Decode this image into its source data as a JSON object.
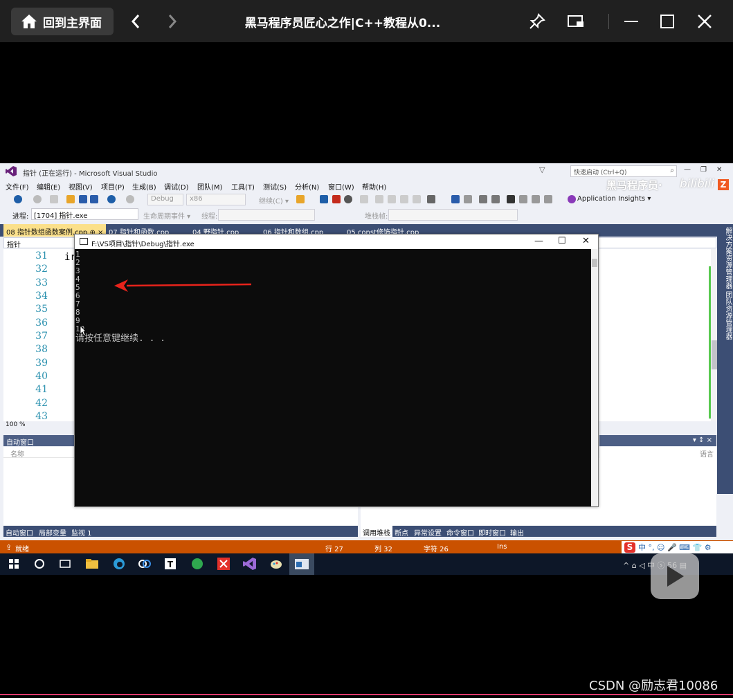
{
  "player": {
    "home_label": "回到主界面",
    "title": "黑马程序员匠心之作|C++教程从0..."
  },
  "vs": {
    "window_title": "指针 (正在运行) - Microsoft Visual Studio",
    "quick_launch": "快速启动 (Ctrl+Q)",
    "menu": [
      "文件(F)",
      "编辑(E)",
      "视图(V)",
      "项目(P)",
      "生成(B)",
      "调试(D)",
      "团队(M)",
      "工具(T)",
      "测试(S)",
      "分析(N)",
      "窗口(W)",
      "帮助(H)"
    ],
    "brand": "黑马程序员·",
    "brand_bili": "bilibili",
    "brand_z": "Z",
    "toolbar": {
      "config": "Debug",
      "platform": "x86",
      "continue": "继续(C) ▾",
      "app_insights": "Application Insights ▾"
    },
    "toolbar2": {
      "process_label": "进程:",
      "process_value": "[1704] 指针.exe",
      "lifecycle": "生命周期事件 ▾",
      "thread_label": "线程:",
      "stackframe_label": "堆栈帧:"
    },
    "tabs": [
      "08 指针数组函数案例.cpp",
      "07 指针和函数.cpp",
      "04 野指针.cpp",
      "06 指针和数组.cpp",
      "05 const修饰指针.cpp"
    ],
    "tab_pin": "⊕ ×",
    "nav_scope": "指针",
    "line_numbers": [
      "31",
      "32",
      "33",
      "34",
      "35",
      "36",
      "37",
      "38",
      "39",
      "40",
      "41",
      "42",
      "43"
    ],
    "code_fragment": "ir",
    "zoom": "100 %",
    "right_rail": "解决方案资源管理器  团队资源管理器",
    "auto_window": {
      "title": "自动窗口",
      "column_name": "名称"
    },
    "callstack": {
      "pin": "▾ ↕ ×",
      "column_lang": "语言"
    },
    "bottom_tabs_left": [
      "自动窗口",
      "局部变量",
      "监视 1"
    ],
    "bottom_tabs_right": [
      "调用堆栈",
      "断点",
      "异常设置",
      "命令窗口",
      "即时窗口",
      "输出"
    ],
    "status": {
      "ready": "就绪",
      "row": "行 27",
      "col": "列 32",
      "char": "字符 26",
      "ins": "Ins"
    },
    "ime": {
      "s": "S",
      "items": "中 °, ☺ 🎤 ⌨ 👕 ⚙"
    },
    "tray": "^ ⌂ ◁ 中 ⓢ 56 ▤"
  },
  "console": {
    "title": "F:\\VS项目\\指针\\Debug\\指针.exe",
    "lines": [
      "1",
      "2",
      "3",
      "4",
      "5",
      "6",
      "7",
      "8",
      "9",
      "10",
      "请按任意键继续. . ."
    ]
  },
  "watermark": "CSDN @励志君10086",
  "colors": {
    "statusbar": "#ca5100",
    "vs_tab_bg": "#3c4e74",
    "active_tab": "#fbe08a",
    "arrow": "#e8231b"
  }
}
